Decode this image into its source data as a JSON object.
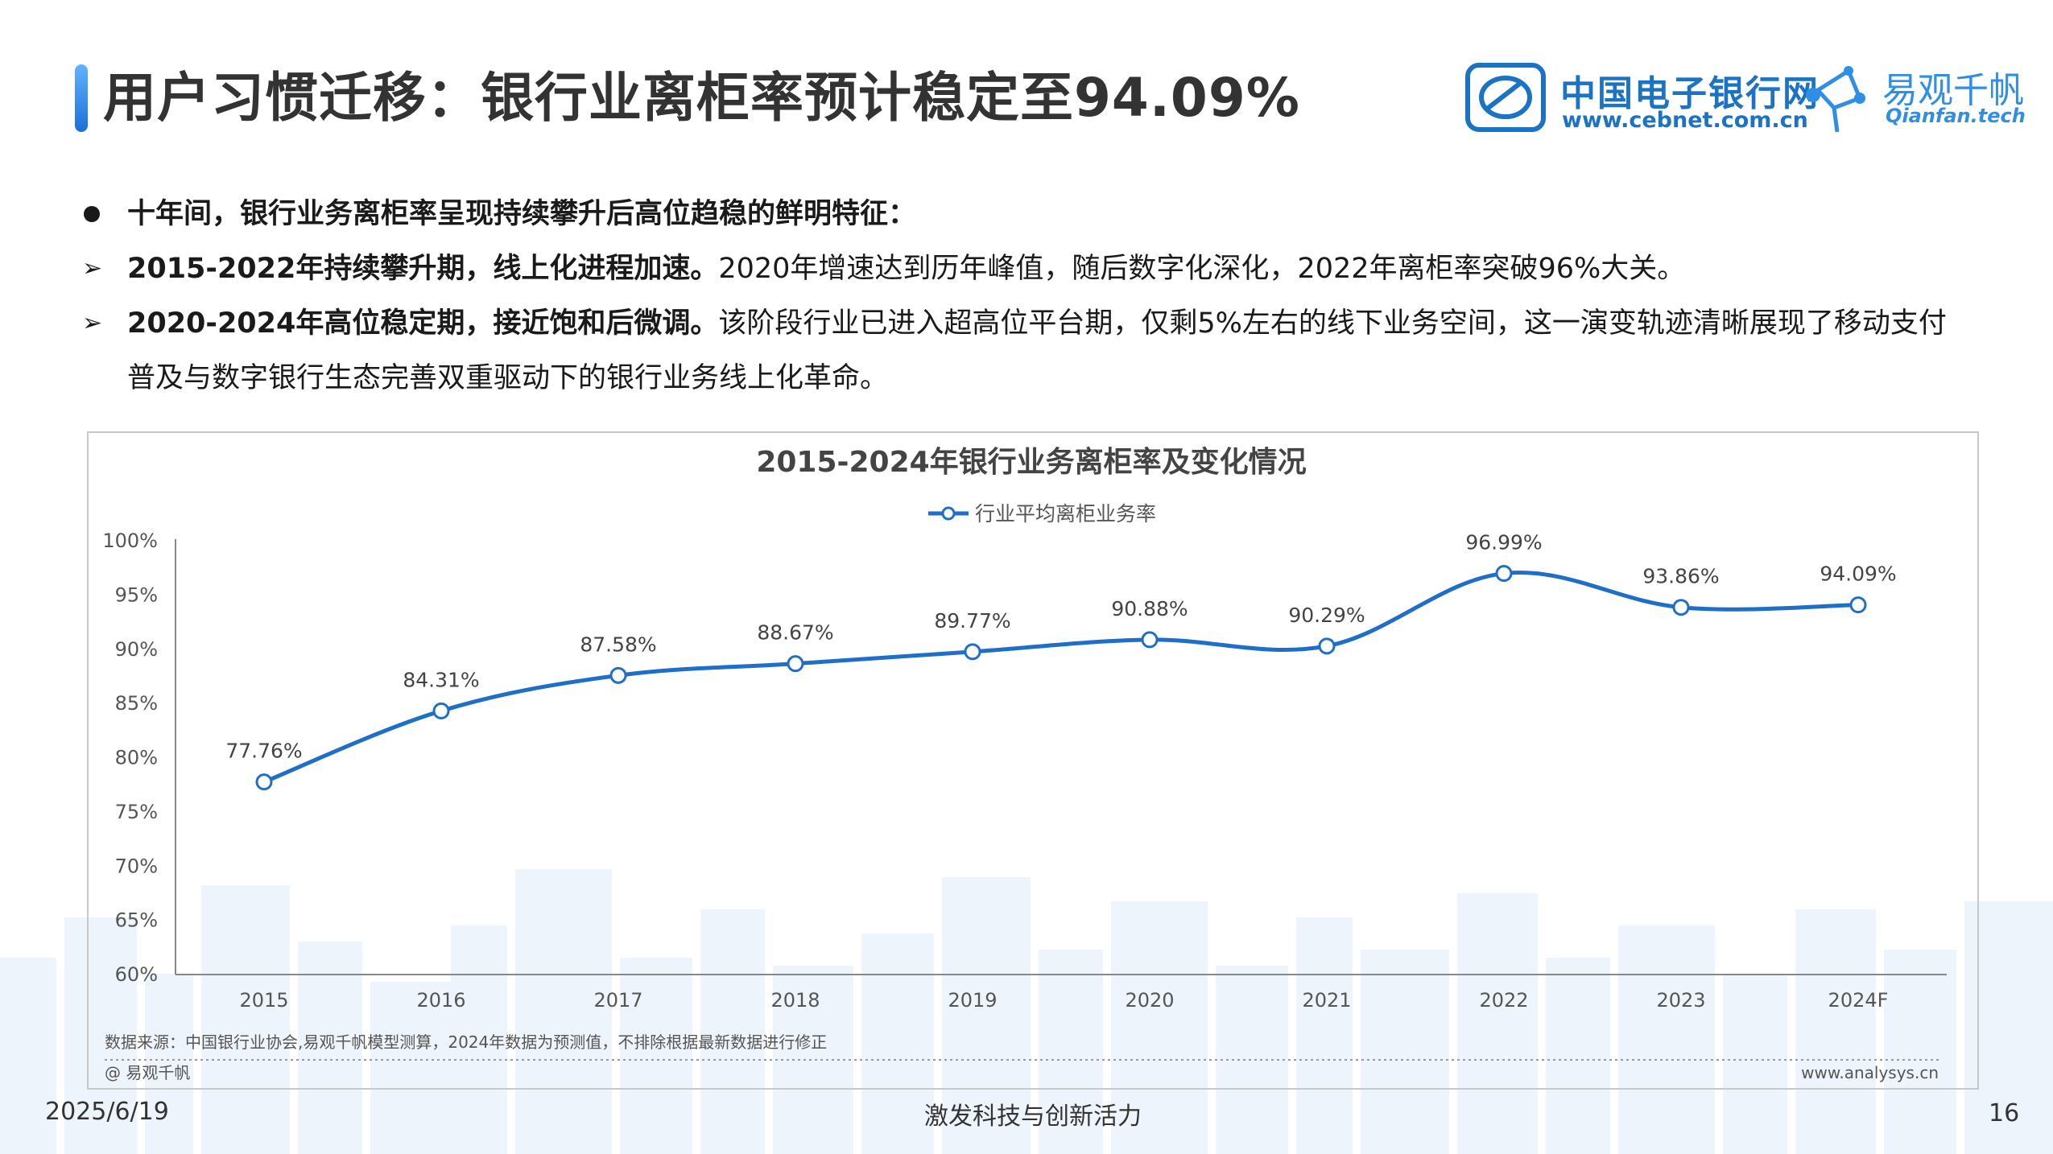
{
  "header": {
    "title": "用户习惯迁移：银行业离柜率预计稳定至94.09%",
    "logo_cebnet_name": "中国电子银行网",
    "logo_cebnet_url": "www.cebnet.com.cn",
    "logo_qianfan_name": "易观千帆",
    "logo_qianfan_url": "Qianfan.tech"
  },
  "bullets": {
    "summary": "十年间，银行业务离柜率呈现持续攀升后高位趋稳的鲜明特征：",
    "point1_bold": "2015-2022年持续攀升期，线上化进程加速。",
    "point1_text": "2020年增速达到历年峰值，随后数字化深化，2022年离柜率突破96%大关。",
    "point2_bold": "2020-2024年高位稳定期，接近饱和后微调。",
    "point2_text": "该阶段行业已进入超高位平台期，仅剩5%左右的线下业务空间，这一演变轨迹清晰展现了移动支付普及与数字银行生态完善双重驱动下的银行业务线上化革命。"
  },
  "chart_data": {
    "type": "line",
    "title": "2015-2024年银行业务离柜率及变化情况",
    "categories": [
      "2015",
      "2016",
      "2017",
      "2018",
      "2019",
      "2020",
      "2021",
      "2022",
      "2023",
      "2024F"
    ],
    "series": [
      {
        "name": "行业平均离柜业务率",
        "values": [
          77.76,
          84.31,
          87.58,
          88.67,
          89.77,
          90.88,
          90.29,
          96.99,
          93.86,
          94.09
        ],
        "labels": [
          "77.76%",
          "84.31%",
          "87.58%",
          "88.67%",
          "89.77%",
          "90.88%",
          "90.29%",
          "96.99%",
          "93.86%",
          "94.09%"
        ],
        "color": "#1f6fc9"
      }
    ],
    "ylim": [
      60,
      100
    ],
    "yticks": [
      "60%",
      "65%",
      "70%",
      "75%",
      "80%",
      "85%",
      "90%",
      "95%",
      "100%"
    ],
    "ytick_values": [
      60,
      65,
      70,
      75,
      80,
      85,
      90,
      95,
      100
    ],
    "legend_position": "top-center",
    "grid": false,
    "smooth": true
  },
  "chart_footer": {
    "source": "数据来源：中国银行业协会,易观千帆模型测算，2024年数据为预测值，不排除根据最新数据进行修正",
    "copyright": "@ 易观千帆",
    "website": "www.analysys.cn"
  },
  "footer": {
    "date": "2025/6/19",
    "slogan": "激发科技与创新活力",
    "page": "16"
  }
}
